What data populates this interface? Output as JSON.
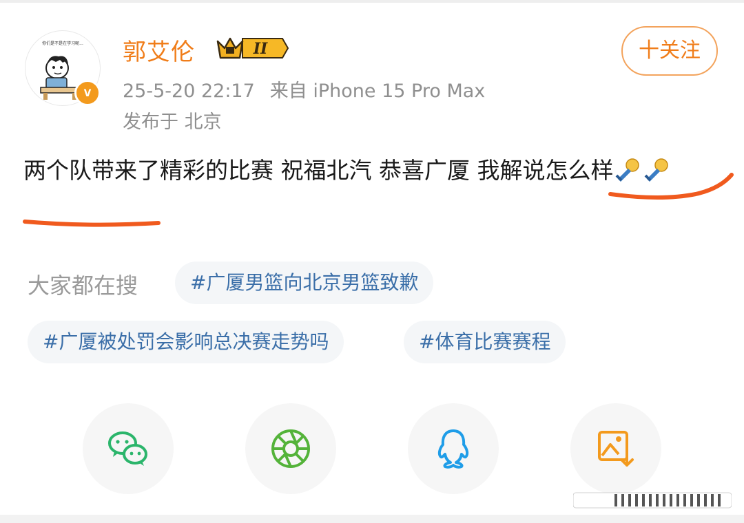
{
  "post": {
    "author": "郭艾伦",
    "badge_text": "II",
    "timestamp": "25-5-20 22:17",
    "source": "来自 iPhone 15 Pro Max",
    "location": "发布于 北京",
    "follow_label": "十关注",
    "content": "两个队带来了精彩的比赛 祝福北汽 恭喜广厦 我解说怎么样",
    "avatar_caption": "你们是不是在学习呢...",
    "verified_mark": "v"
  },
  "trending": {
    "label": "大家都在搜",
    "topics": [
      "#广厦男篮向北京男篮致歉",
      "#广厦被处罚会影响总决赛走势吗",
      "#体育比赛赛程"
    ]
  },
  "share": {
    "targets": [
      "wechat-icon",
      "moments-icon",
      "qq-icon",
      "save-image-icon"
    ]
  },
  "colors": {
    "accent": "#f07d1a",
    "topic_link": "#3a6ea8",
    "muted": "#8f8f8f",
    "underline": "#f05a1e",
    "wechat": "#2bb56b",
    "moments": "#54b33a",
    "qq": "#1f9de8",
    "save": "#f39a1d"
  }
}
